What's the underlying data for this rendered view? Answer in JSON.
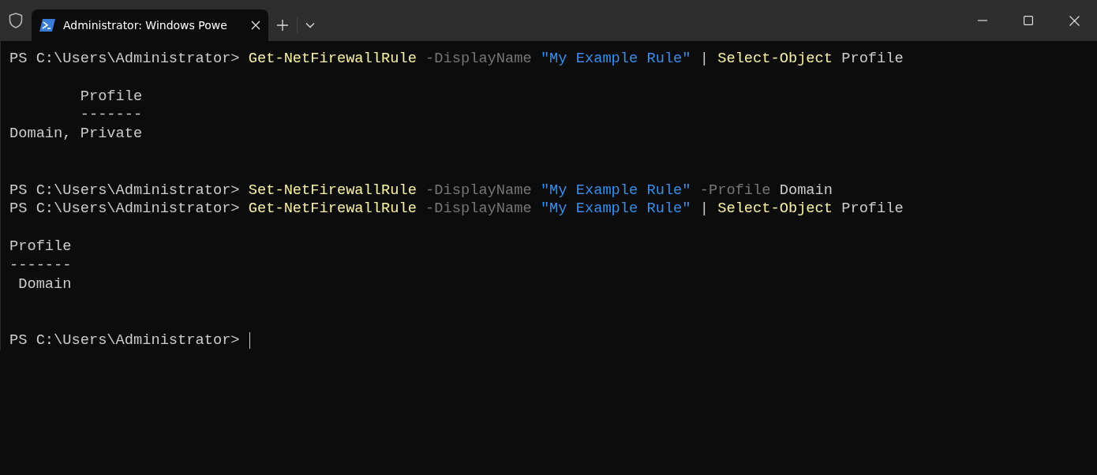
{
  "tab": {
    "title": "Administrator: Windows Powe",
    "selected": true
  },
  "lines": [
    {
      "kind": "text",
      "segments": [
        {
          "kind": "prompt",
          "text": "PS C:\\Users\\Administrator> "
        },
        {
          "kind": "command",
          "text": "Get-NetFirewallRule"
        },
        {
          "kind": "parameter",
          "text": " -DisplayName "
        },
        {
          "kind": "string",
          "text": "\"My Example Rule\""
        },
        {
          "kind": "plain",
          "text": " | "
        },
        {
          "kind": "command",
          "text": "Select-Object"
        },
        {
          "kind": "plain",
          "text": " Profile"
        }
      ]
    },
    {
      "kind": "blank"
    },
    {
      "kind": "text",
      "segments": [
        {
          "kind": "plain",
          "text": "        Profile"
        }
      ]
    },
    {
      "kind": "text",
      "segments": [
        {
          "kind": "plain",
          "text": "        -------"
        }
      ]
    },
    {
      "kind": "text",
      "segments": [
        {
          "kind": "plain",
          "text": "Domain, Private"
        }
      ]
    },
    {
      "kind": "blank"
    },
    {
      "kind": "blank"
    },
    {
      "kind": "text",
      "segments": [
        {
          "kind": "prompt",
          "text": "PS C:\\Users\\Administrator> "
        },
        {
          "kind": "command",
          "text": "Set-NetFirewallRule"
        },
        {
          "kind": "parameter",
          "text": " -DisplayName "
        },
        {
          "kind": "string",
          "text": "\"My Example Rule\""
        },
        {
          "kind": "parameter",
          "text": " -Profile"
        },
        {
          "kind": "plain",
          "text": " Domain"
        }
      ]
    },
    {
      "kind": "text",
      "segments": [
        {
          "kind": "prompt",
          "text": "PS C:\\Users\\Administrator> "
        },
        {
          "kind": "command",
          "text": "Get-NetFirewallRule"
        },
        {
          "kind": "parameter",
          "text": " -DisplayName "
        },
        {
          "kind": "string",
          "text": "\"My Example Rule\""
        },
        {
          "kind": "plain",
          "text": " | "
        },
        {
          "kind": "command",
          "text": "Select-Object"
        },
        {
          "kind": "plain",
          "text": " Profile"
        }
      ]
    },
    {
      "kind": "blank"
    },
    {
      "kind": "text",
      "segments": [
        {
          "kind": "plain",
          "text": "Profile"
        }
      ]
    },
    {
      "kind": "text",
      "segments": [
        {
          "kind": "plain",
          "text": "-------"
        }
      ]
    },
    {
      "kind": "text",
      "segments": [
        {
          "kind": "plain",
          "text": " Domain"
        }
      ]
    },
    {
      "kind": "blank"
    },
    {
      "kind": "blank"
    },
    {
      "kind": "text",
      "cursor": true,
      "segments": [
        {
          "kind": "prompt",
          "text": "PS C:\\Users\\Administrator> "
        }
      ]
    }
  ]
}
